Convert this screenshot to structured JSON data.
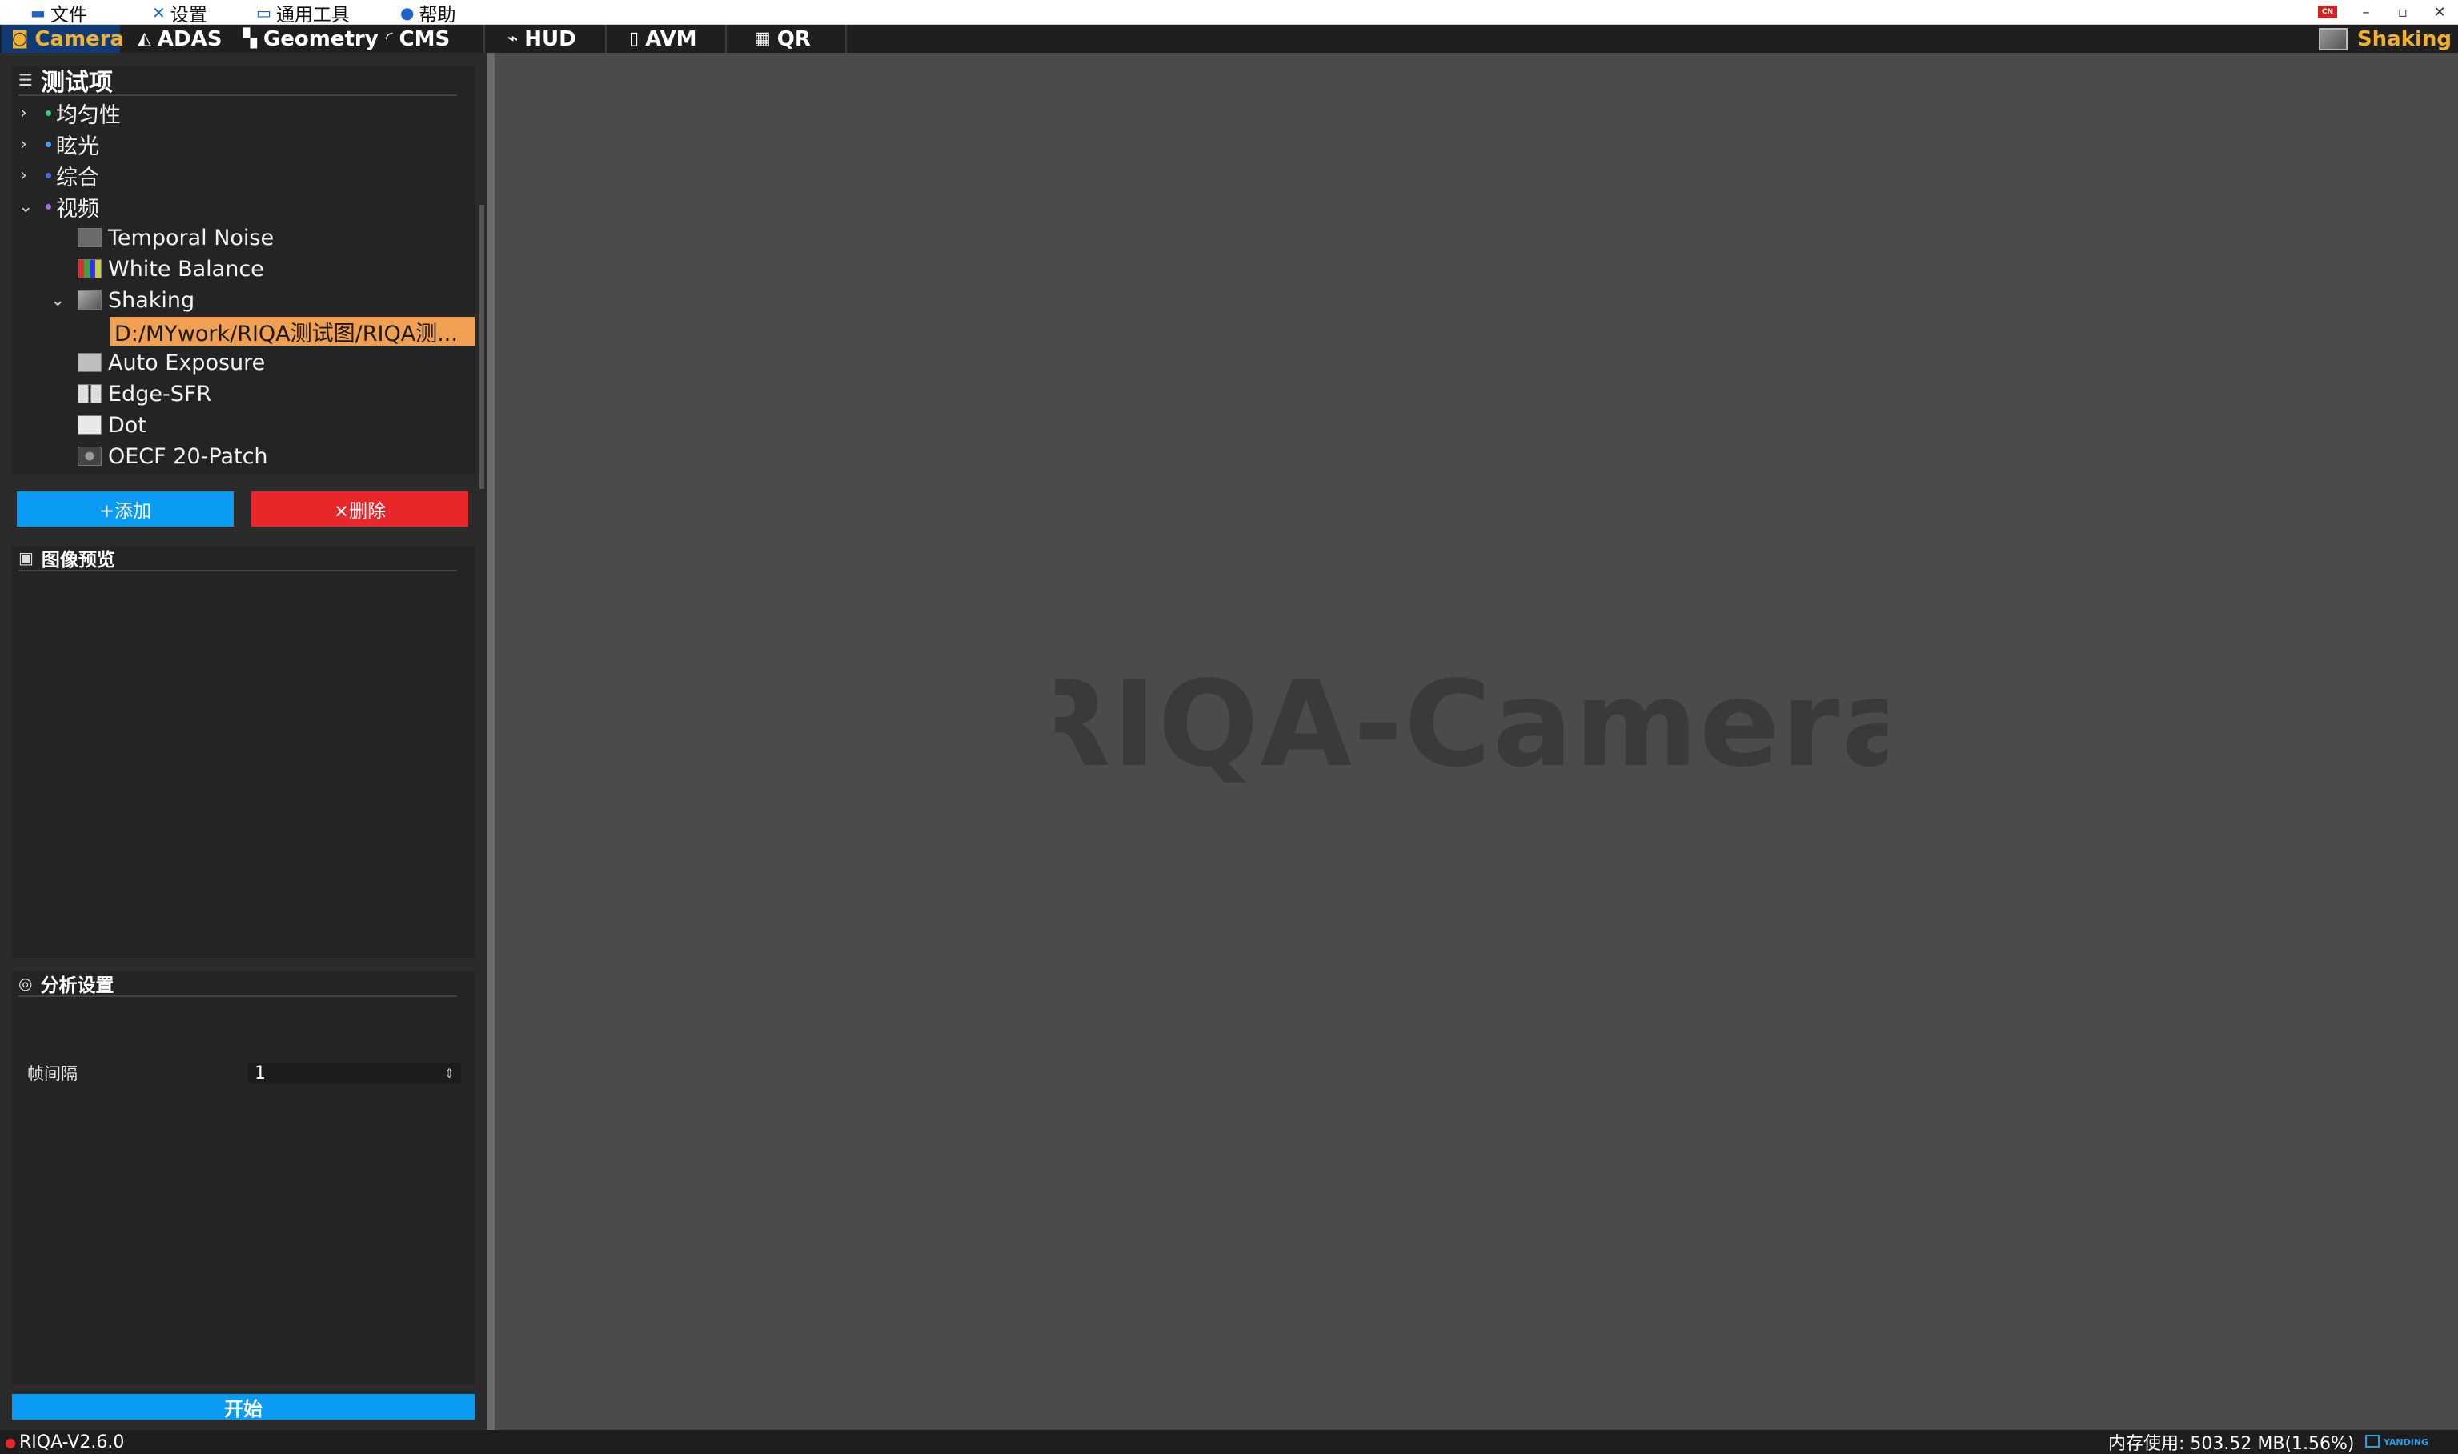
{
  "menu": {
    "file": "文件",
    "settings": "设置",
    "tools": "通用工具",
    "help": "帮助"
  },
  "window_controls": {
    "lang_badge": "CN",
    "minimize": "–",
    "maximize": "▫",
    "close": "✕"
  },
  "modules": [
    {
      "label": "Camera",
      "icon": "camera-icon"
    },
    {
      "label": "ADAS",
      "icon": "adas-icon"
    },
    {
      "label": "Geometry",
      "icon": "checkerboard-icon"
    },
    {
      "label": "CMS",
      "icon": "mirror-icon"
    },
    {
      "label": "HUD",
      "icon": "hud-icon"
    },
    {
      "label": "AVM",
      "icon": "car-icon"
    },
    {
      "label": "QR",
      "icon": "qr-icon"
    }
  ],
  "current_item": "Shaking",
  "test_items": {
    "title": "测试项",
    "categories": [
      {
        "label": "均匀性",
        "dot_color": "#2fd27a",
        "expanded": false
      },
      {
        "label": "眩光",
        "dot_color": "#39a0ff",
        "expanded": false
      },
      {
        "label": "综合",
        "dot_color": "#3a6ff0",
        "expanded": false
      },
      {
        "label": "视频",
        "dot_color": "#9a6ff0",
        "expanded": true
      }
    ],
    "video_items": [
      {
        "label": "Temporal Noise",
        "icon": "gray-swatch-icon"
      },
      {
        "label": "White Balance",
        "icon": "colorchecker-icon"
      },
      {
        "label": "Shaking",
        "icon": "shaking-chart-icon"
      },
      {
        "label": "Auto Exposure",
        "icon": "light-gray-swatch-icon"
      },
      {
        "label": "Edge-SFR",
        "icon": "edge-chart-icon"
      },
      {
        "label": "Dot",
        "icon": "white-swatch-icon"
      },
      {
        "label": "OECF 20-Patch",
        "icon": "oecf-chart-icon"
      }
    ],
    "selected_file": "D:/MYwork/RIQA测试图/RIQA测..."
  },
  "buttons": {
    "add": "+添加",
    "delete": "×删除",
    "start": "开始"
  },
  "preview": {
    "title": "图像预览"
  },
  "analysis": {
    "title": "分析设置",
    "frame_interval_label": "帧间隔",
    "frame_interval_value": "1"
  },
  "watermark": "RIQA-Camera",
  "status": {
    "version": "RIQA-V2.6.0",
    "memory": "内存使用: 503.52 MB(1.56%)",
    "brand": "YANDING"
  },
  "colors": {
    "accent_blue": "#0a9bf5",
    "delete_red": "#e8272a",
    "selected_orange": "#f0a050",
    "active_tab_text": "#f0b030"
  }
}
